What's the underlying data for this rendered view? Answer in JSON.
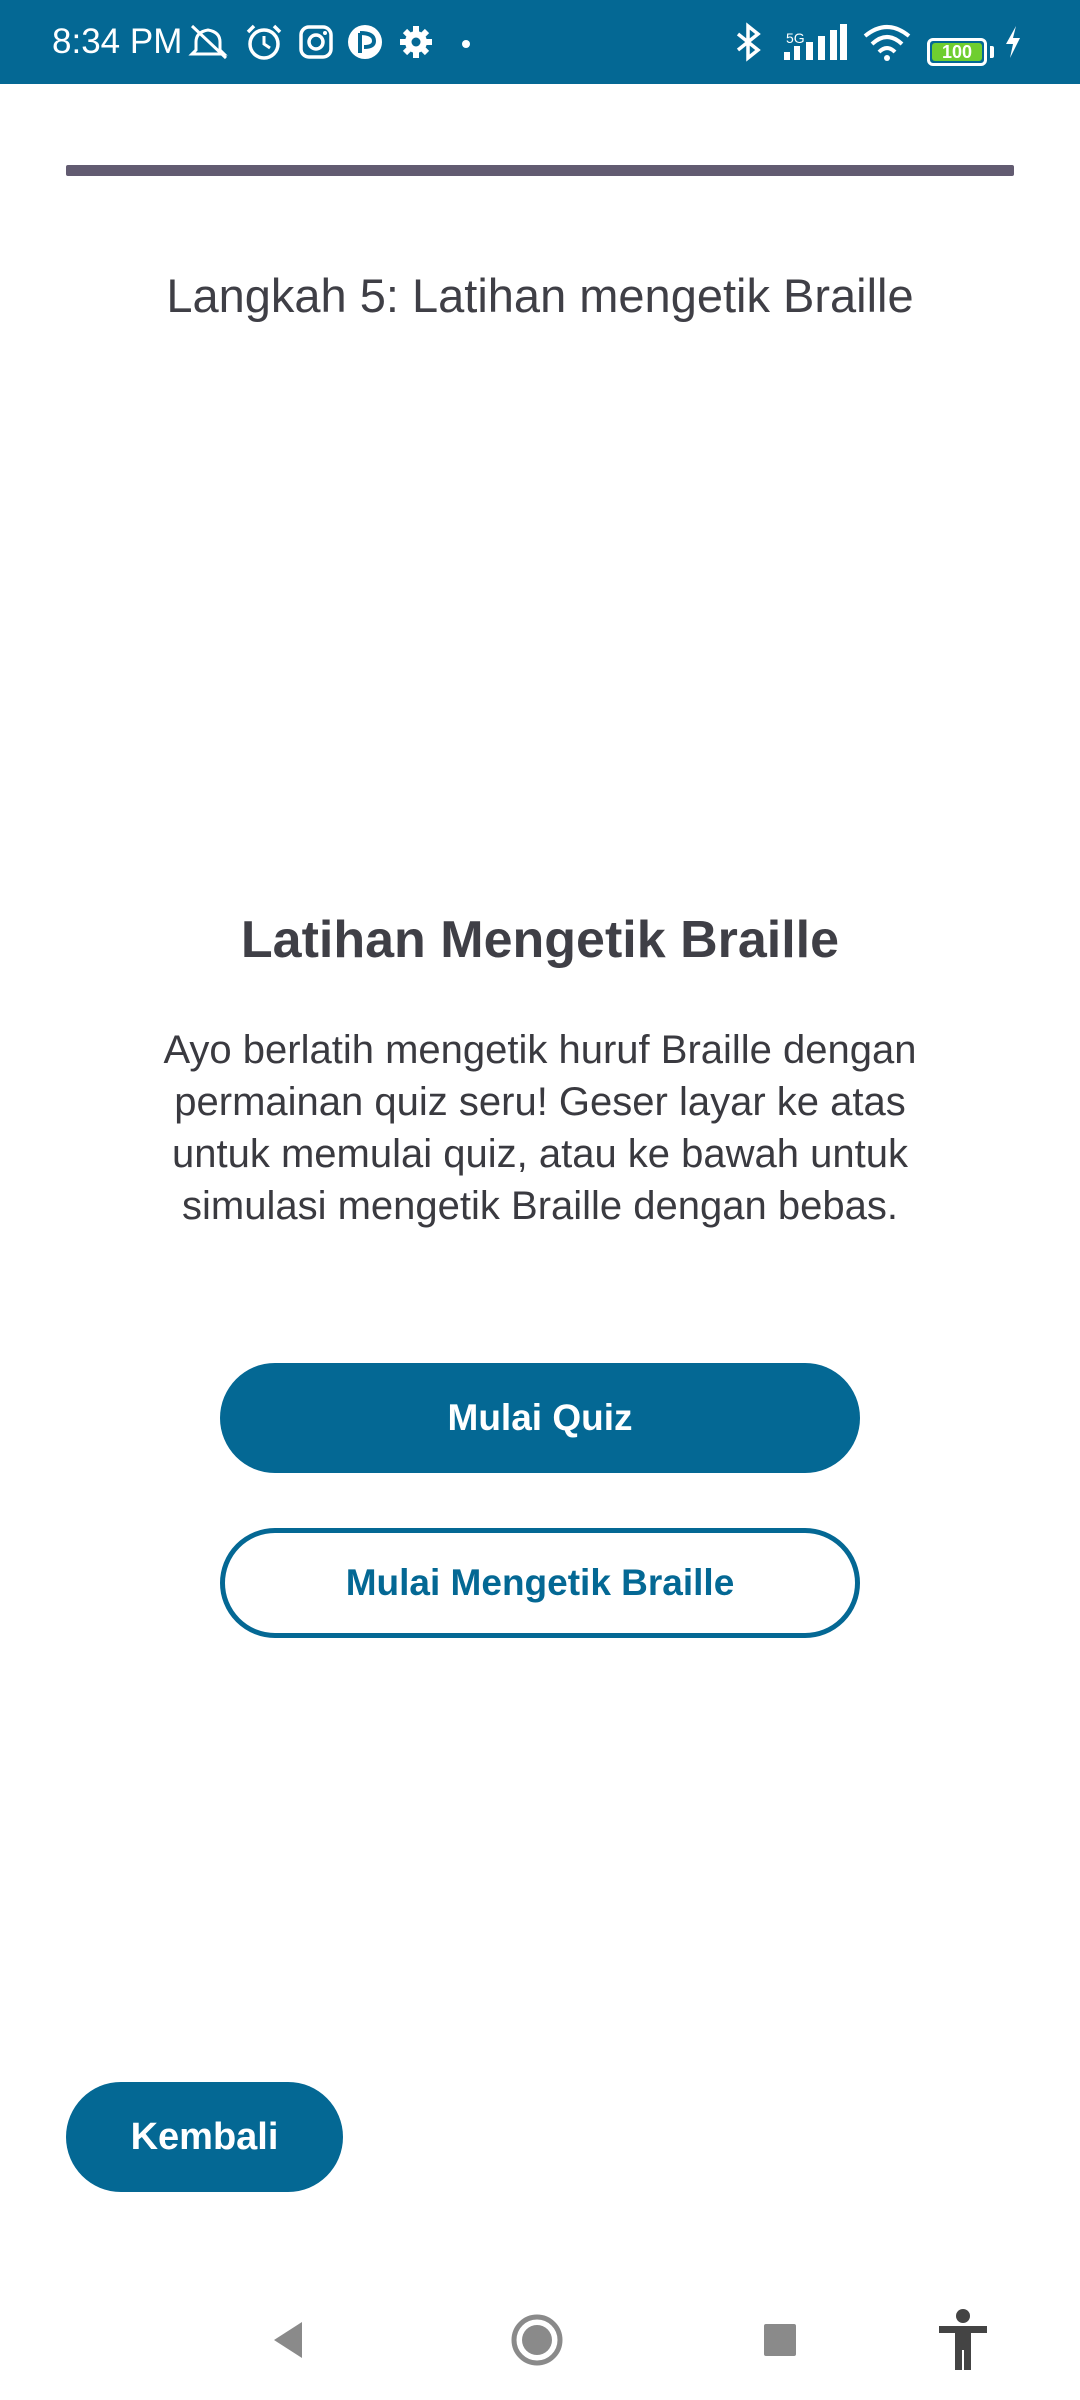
{
  "status_bar": {
    "time": "8:34 PM",
    "network_label": "5G",
    "battery_level": "100",
    "icons": [
      "mute-icon",
      "alarm-icon",
      "instagram-icon",
      "app-icon",
      "settings-icon",
      "dot-icon",
      "bluetooth-icon",
      "signal-icon",
      "wifi-icon",
      "battery-icon",
      "charging-icon"
    ],
    "background_color": "#046894"
  },
  "progress": {
    "value_fraction": 1.0,
    "color": "#625b71"
  },
  "step": {
    "title": "Langkah 5: Latihan mengetik Braille"
  },
  "card": {
    "title": "Latihan Mengetik Braille",
    "description": "Ayo berlatih mengetik huruf Braille dengan permainan quiz seru! Geser layar ke atas untuk memulai quiz, atau ke bawah untuk simulasi mengetik Braille dengan bebas."
  },
  "buttons": {
    "start_quiz": "Mulai Quiz",
    "start_typing": "Mulai Mengetik Braille",
    "back": "Kembali"
  },
  "nav_bar": {
    "items": [
      "back-icon",
      "home-icon",
      "recents-icon",
      "accessibility-icon"
    ]
  },
  "colors": {
    "accent": "#046894",
    "text": "#3f3f46"
  }
}
